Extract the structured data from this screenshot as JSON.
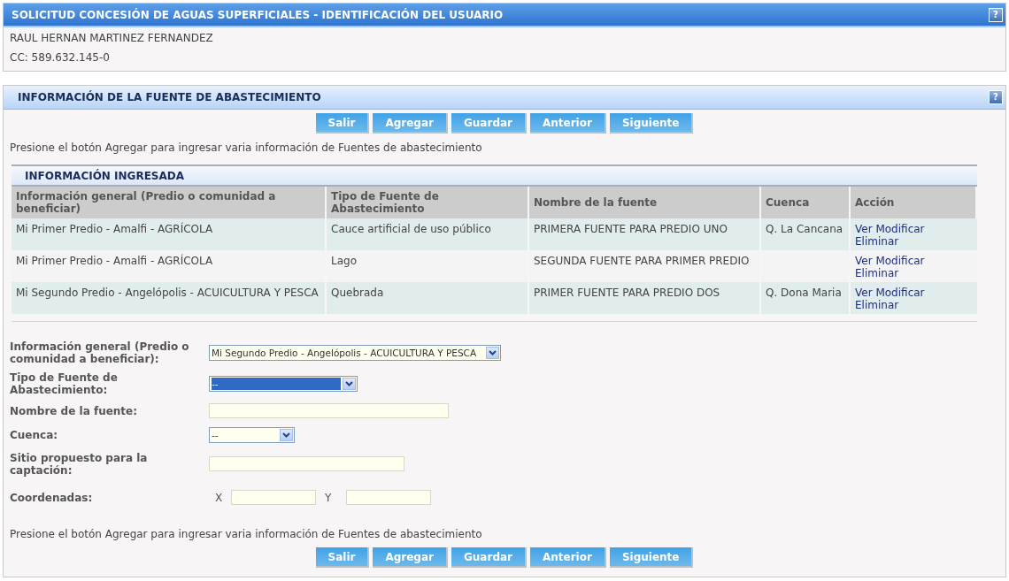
{
  "user_panel": {
    "title": "SOLICITUD CONCESIÓN DE AGUAS SUPERFICIALES - IDENTIFICACIÓN DEL USUARIO",
    "help": "?",
    "lines": [
      "RAUL HERNAN MARTINEZ FERNANDEZ",
      "CC: 589.632.145-0"
    ]
  },
  "source_panel": {
    "title": "INFORMACIÓN DE LA FUENTE DE ABASTECIMIENTO",
    "help": "?",
    "buttons_top": [
      "Salir",
      "Agregar",
      "Guardar",
      "Anterior",
      "Siguiente"
    ],
    "hint_top": "Presione el botón Agregar para ingresar varia información de Fuentes de abastecimiento",
    "table": {
      "title": "INFORMACIÓN INGRESADA",
      "columns": [
        "Información general (Predio o comunidad a beneficiar)",
        "Tipo de Fuente de Abastecimiento",
        "Nombre de la fuente",
        "Cuenca",
        "Acción"
      ],
      "rows": [
        {
          "cells": [
            "Mi Primer Predio - Amalfi - AGRÍCOLA",
            "Cauce artificial de uso público",
            "PRIMERA FUENTE PARA PREDIO UNO",
            "Q. La Cancana"
          ],
          "actions": [
            "Ver",
            "Modificar",
            "Eliminar"
          ]
        },
        {
          "cells": [
            "Mi Primer Predio - Amalfi - AGRÍCOLA",
            "Lago",
            "SEGUNDA FUENTE PARA PRIMER PREDIO",
            ""
          ],
          "actions": [
            "Ver",
            "Modificar",
            "Eliminar"
          ]
        },
        {
          "cells": [
            "Mi Segundo Predio - Angelópolis - ACUICULTURA Y PESCA",
            "Quebrada",
            "PRIMER FUENTE PARA PREDIO DOS",
            "Q. Dona Maria"
          ],
          "actions": [
            "Ver",
            "Modificar",
            "Eliminar"
          ]
        }
      ]
    },
    "form": [
      {
        "kind": "select",
        "label": "Información general (Predio o comunidad a beneficiar):",
        "value": "Mi Segundo Predio - Angelópolis - ACUICULTURA Y PESCA",
        "focused": false
      },
      {
        "kind": "select",
        "label": "Tipo de Fuente de Abastecimiento:",
        "value": "--",
        "focused": true
      },
      {
        "kind": "text",
        "label": "Nombre de la fuente:"
      },
      {
        "kind": "select",
        "label": "Cuenca:",
        "value": "--",
        "focused": false
      },
      {
        "kind": "text",
        "label": "Sitio propuesto para la captación:"
      },
      {
        "kind": "coords",
        "label": "Coordenadas:",
        "x_label": "X",
        "y_label": "Y"
      }
    ],
    "hint_bottom": "Presione el botón Agregar para ingresar varia información de Fuentes de abastecimiento",
    "buttons_bottom": [
      "Salir",
      "Agregar",
      "Guardar",
      "Anterior",
      "Siguiente"
    ]
  }
}
